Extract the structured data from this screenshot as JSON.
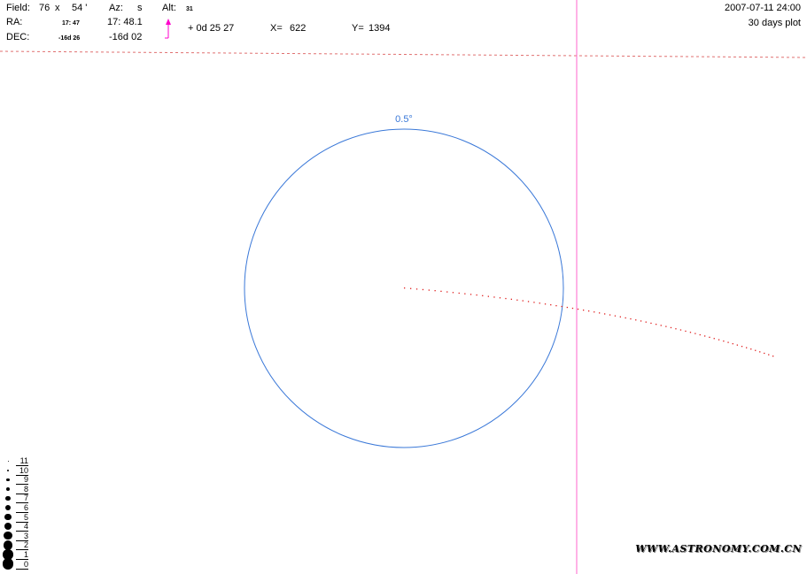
{
  "header": {
    "field_label": "Field:",
    "field_w": "76",
    "field_x": "x",
    "field_h": "54 '",
    "az_label": "Az:",
    "az_value": "s",
    "alt_label": "Alt:",
    "alt_value": "31",
    "ra_label": "RA:",
    "ra_small": "17: 47",
    "ra_value": "17: 48.1",
    "dec_label": "DEC:",
    "dec_small": "-16d 26",
    "dec_value": "-16d 02",
    "offset_value": "+ 0d 25 27",
    "x_label": "X=",
    "x_value": "622",
    "y_label": "Y=",
    "y_value": "1394",
    "date": "2007-07-11  24:00",
    "plot_span": "30 days plot"
  },
  "circle_label": "0.5°",
  "magnitude_scale": [
    "11",
    "10",
    "9",
    "8",
    "7",
    "6",
    "5",
    "4",
    "3",
    "2",
    "1",
    "0"
  ],
  "watermark": "WWW.ASTRONOMY.COM.CN",
  "colors": {
    "circle": "#3a78d8",
    "crosshair": "#ff66cc",
    "track": "#e02020",
    "horizon": "#e07070",
    "arrow": "#ff00cc"
  }
}
